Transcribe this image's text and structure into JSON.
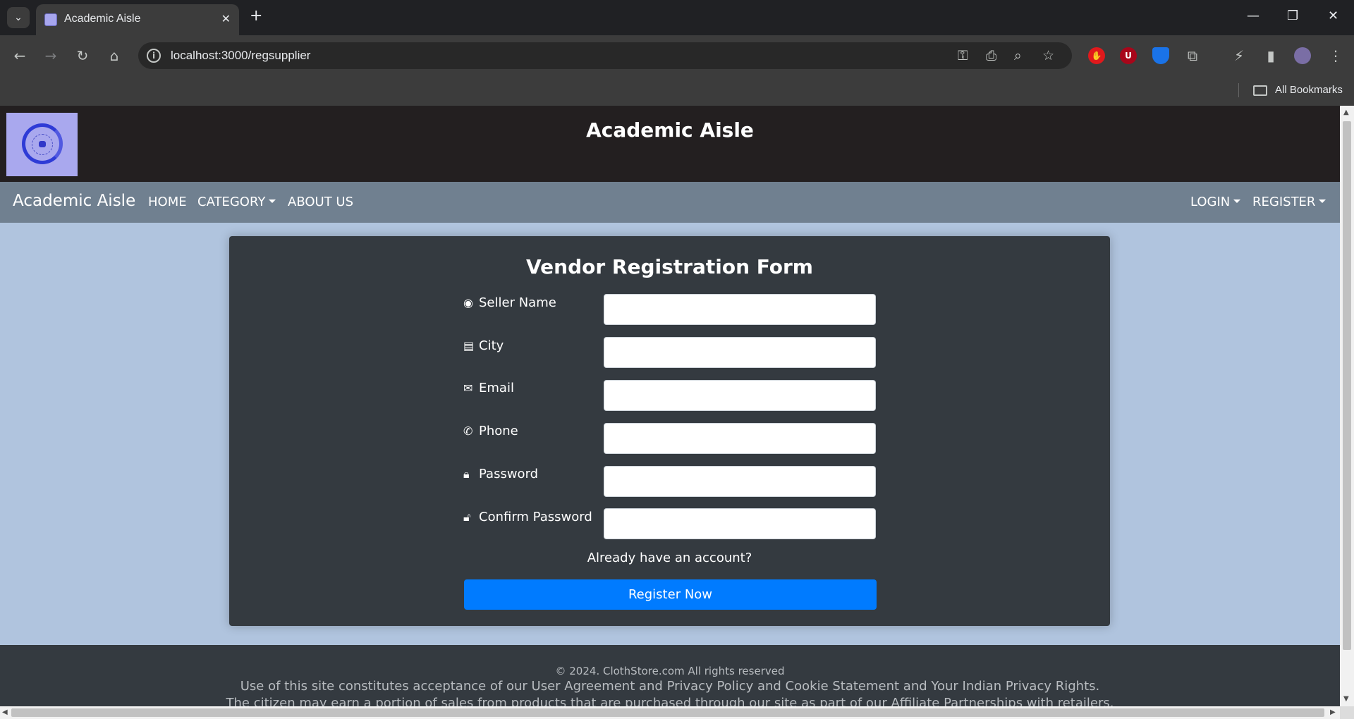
{
  "browser": {
    "tab_title": "Academic Aisle",
    "url": "localhost:3000/regsupplier",
    "bookmarks_label": "All Bookmarks"
  },
  "header": {
    "title": "Academic Aisle"
  },
  "nav": {
    "brand": "Academic Aisle",
    "home": "HOME",
    "category": "CATEGORY",
    "about": "ABOUT US",
    "login": "LOGIN",
    "register": "REGISTER"
  },
  "form": {
    "title": "Vendor Registration Form",
    "fields": [
      {
        "label": "Seller Name",
        "icon": "user-circle-icon",
        "value": ""
      },
      {
        "label": "City",
        "icon": "id-card-icon",
        "value": ""
      },
      {
        "label": "Email",
        "icon": "envelope-icon",
        "value": ""
      },
      {
        "label": "Phone",
        "icon": "phone-icon",
        "value": ""
      },
      {
        "label": "Password",
        "icon": "lock-icon",
        "value": ""
      },
      {
        "label": "Confirm Password",
        "icon": "unlock-icon",
        "value": ""
      }
    ],
    "have_account": "Already have an account?",
    "submit": "Register Now"
  },
  "footer": {
    "copyright": "© 2024. ClothStore.com All rights reserved",
    "terms": "Use of this site constitutes acceptance of our User Agreement and Privacy Policy and Cookie Statement and Your Indian Privacy Rights.",
    "affiliate": "The citizen may earn a portion of sales from products that are purchased through our site as part of our Affiliate Partnerships with retailers."
  },
  "colors": {
    "page_bg": "#b0c4de",
    "header_bg": "#231f20",
    "nav_bg": "#708090",
    "card_bg": "#343a40",
    "button_bg": "#007bff"
  }
}
